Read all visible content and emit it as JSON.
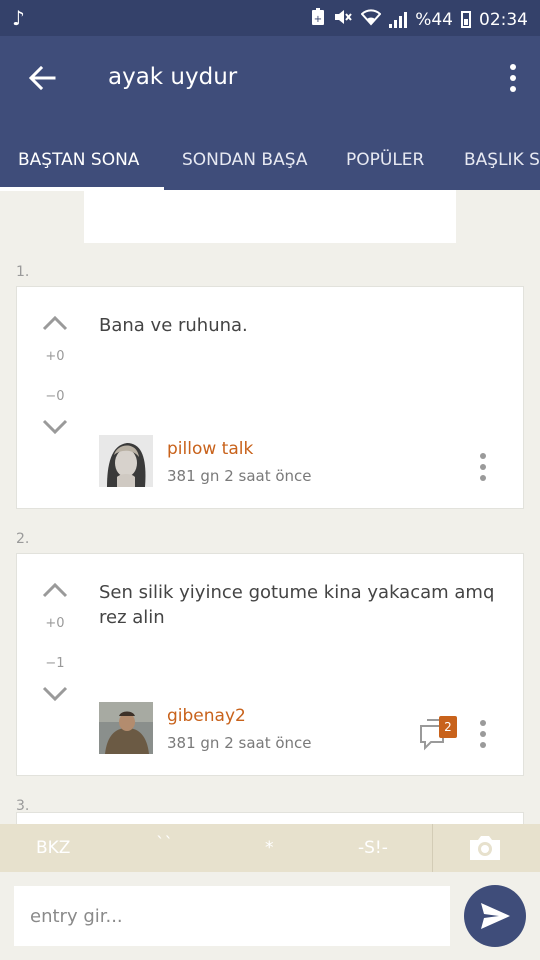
{
  "status_bar": {
    "battery_text": "%44",
    "time": "02:34"
  },
  "app_bar": {
    "title": "ayak uydur",
    "tabs": [
      {
        "label": "BAŞTAN SONA",
        "active": true
      },
      {
        "label": "SONDAN BAŞA",
        "active": false
      },
      {
        "label": "POPÜLER",
        "active": false
      },
      {
        "label": "BAŞLIK S",
        "active": false
      }
    ]
  },
  "entries": [
    {
      "number": "1.",
      "text": "Bana ve ruhuna.",
      "upvotes": "+0",
      "downvotes": "−0",
      "author": "pillow talk",
      "meta": "381 gn 2 saat  önce",
      "comment_count": null
    },
    {
      "number": "2.",
      "text": "Sen silik yiyince gotume kina yakacam amq rez alin",
      "upvotes": "+0",
      "downvotes": "−1",
      "author": "gibenay2",
      "meta": "381 gn 2 saat  önce",
      "comment_count": "2"
    },
    {
      "number": "3."
    }
  ],
  "toolbar": {
    "bkz": "BKZ",
    "backtick": "``",
    "asterisk": "*",
    "spoiler": "-S!-"
  },
  "input": {
    "placeholder": "entry gir..."
  },
  "colors": {
    "primary": "#3f4d7a",
    "status_bar": "#34416a",
    "author": "#c8621b",
    "background": "#f1f0ea",
    "toolbar": "#e7e1cd"
  }
}
